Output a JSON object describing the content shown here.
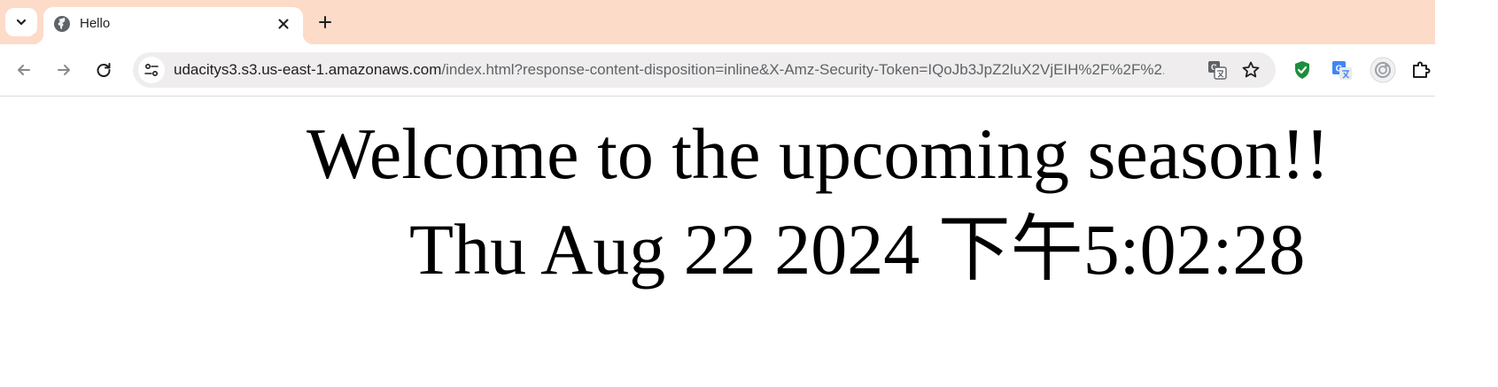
{
  "browser": {
    "tab": {
      "title": "Hello",
      "favicon": "globe-icon"
    },
    "address_bar": {
      "url_host": "udacitys3.s3.us-east-1.amazonaws.com",
      "url_rest": "/index.html?response-content-disposition=inline&X-Amz-Security-Token=IQoJb3JpZ2luX2VjEIH%2F%2F%2..."
    },
    "toolbar_icons": [
      "back-icon",
      "forward-icon",
      "reload-icon",
      "site-info-icon",
      "translate-icon",
      "bookmark-star-icon"
    ],
    "extensions": [
      "shield-check-icon",
      "google-translate-icon",
      "camera-extension-icon",
      "puzzle-icon"
    ]
  },
  "page": {
    "headline": "Welcome to the upcoming season!!",
    "datetime": "Thu Aug 22 2024 下午5:02:28"
  },
  "colors": {
    "tabstrip_bg": "#fddbc9",
    "omnibox_bg": "#efeded",
    "shield_green": "#1e8e3e"
  }
}
